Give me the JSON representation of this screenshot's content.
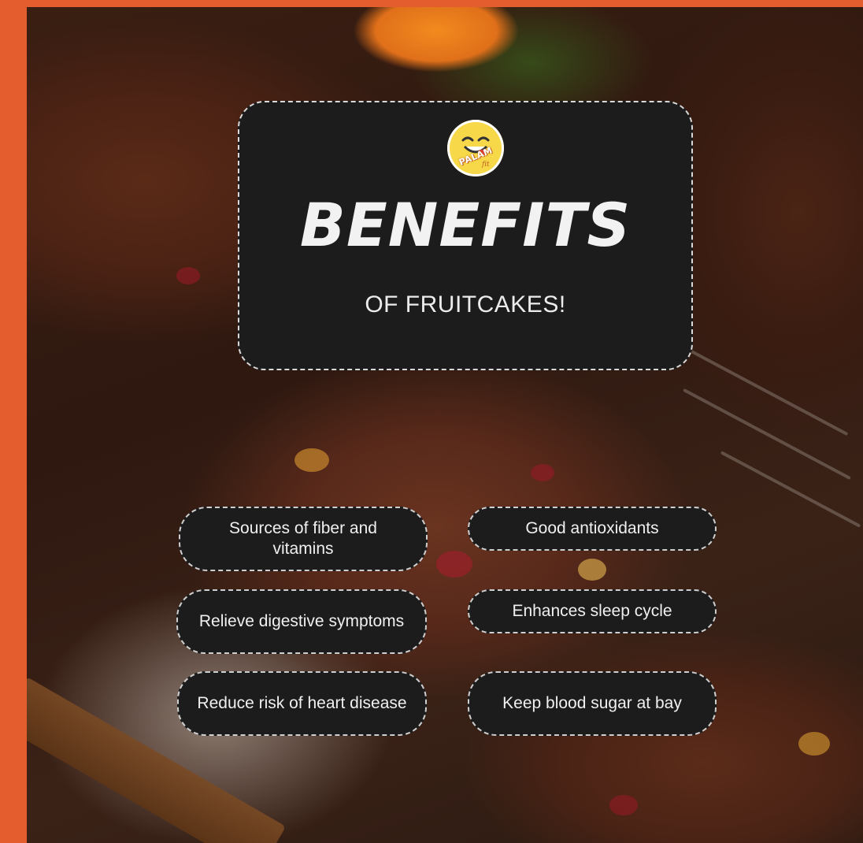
{
  "colors": {
    "frame_orange": "#e35d2f",
    "card_background": "#1c1c1c",
    "text_light": "#f0f0f0",
    "logo_yellow": "#f6d849"
  },
  "logo": {
    "icon": "smiling-face-logo-icon",
    "brand_text": "PALAM",
    "brand_sub": "fit"
  },
  "title": {
    "main": "BENEFITS",
    "sub": "OF FRUITCAKES!"
  },
  "benefits": [
    "Sources of fiber and vitamins",
    "Good antioxidants",
    "Relieve digestive symptoms",
    "Enhances sleep cycle",
    "Reduce risk of heart disease",
    "Keep blood sugar at bay"
  ]
}
